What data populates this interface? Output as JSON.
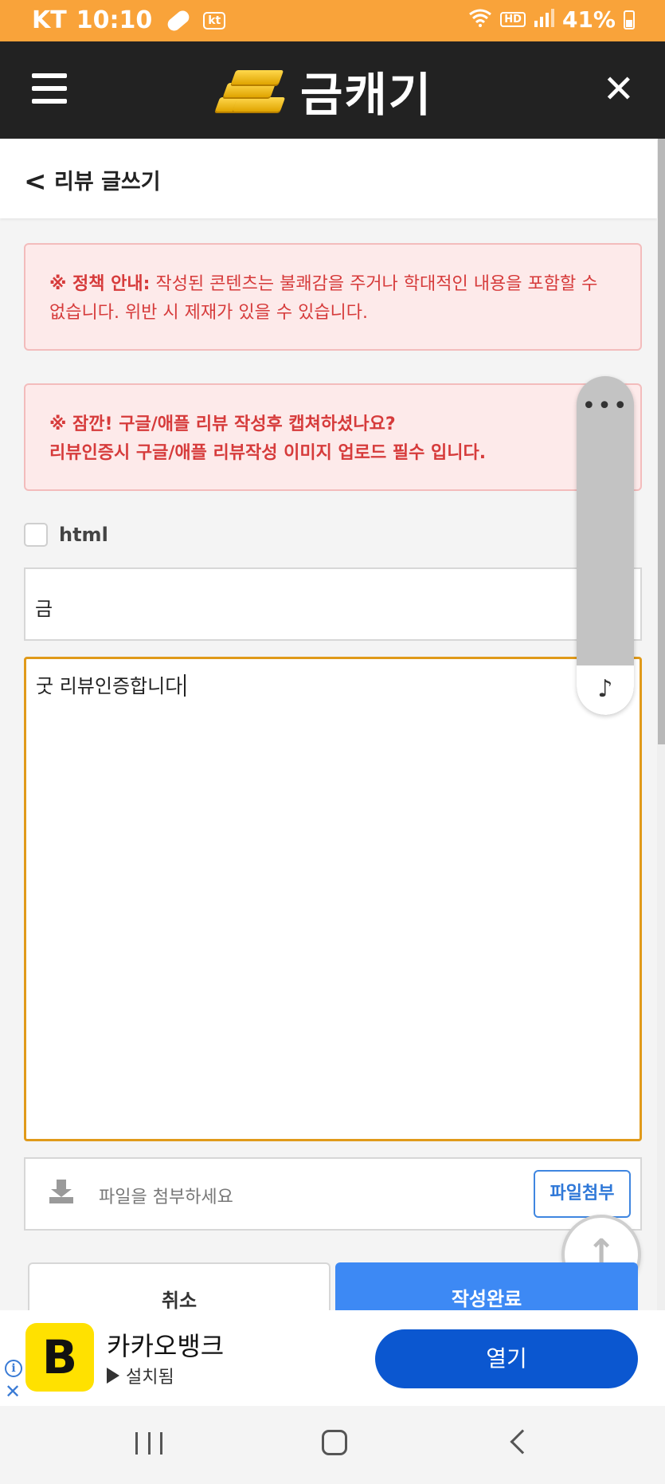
{
  "status_bar": {
    "carrier": "KT",
    "time": "10:10",
    "carrier_badge": "kt",
    "hd_badge": "HD",
    "battery": "41%"
  },
  "app_bar": {
    "title": "금캐기"
  },
  "sub_header": {
    "title": "리뷰 글쓰기"
  },
  "notices": {
    "policy_label": "※ 정책 안내:",
    "policy_text": " 작성된 콘텐츠는 불쾌감을 주거나 학대적인 내용을 포함할 수 없습니다. 위반 시 제재가 있을 수 있습니다.",
    "review_line1": "※ 잠깐! 구글/애플 리뷰 작성후 캡쳐하셨나요?",
    "review_line2": "리뷰인증시 구글/애플 리뷰작성 이미지 업로드 필수 입니다."
  },
  "form": {
    "html_label": "html",
    "subject_value": "금",
    "content_value": "굿  리뷰인증합니다",
    "attach_placeholder": "파일을 첨부하세요",
    "attach_button": "파일첨부",
    "cancel_button": "취소",
    "submit_button": "작성완료"
  },
  "floating_tool": {
    "dots": "•••",
    "note_icon": "♪"
  },
  "ad": {
    "logo_letter": "B",
    "app_name": "카카오뱅크",
    "status": "설치됨",
    "open_button": "열기",
    "info_icon": "i",
    "close_icon": "✕"
  },
  "icons": {
    "menu": "hamburger-icon",
    "close": "close-icon",
    "back": "chevron-left-icon",
    "scroll_top": "arrow-up-icon",
    "attach": "download-icon"
  },
  "colors": {
    "status_bar": "#f9a33a",
    "app_bar": "#222222",
    "notice_text": "#d63b3b",
    "accent_border": "#e09a1a",
    "submit": "#3d89f4",
    "ad_button": "#0b57d0"
  }
}
